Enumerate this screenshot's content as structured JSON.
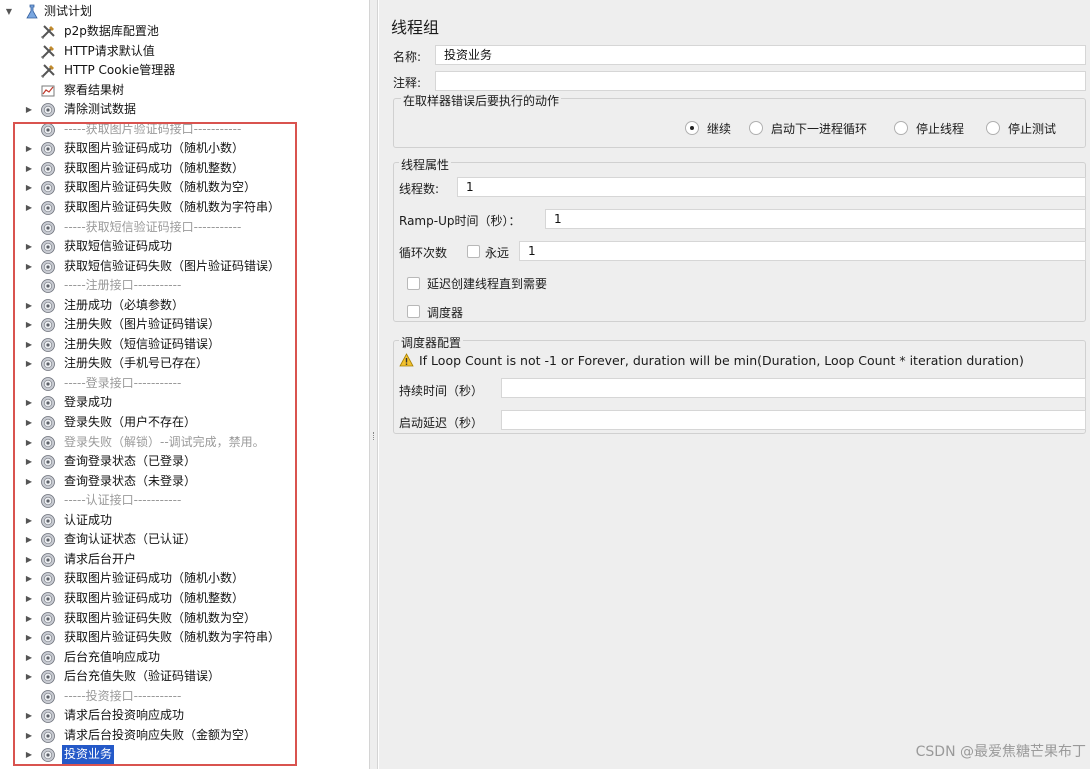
{
  "tree": {
    "root": {
      "label": "测试计划",
      "icon": "test-plan-icon"
    },
    "items": [
      {
        "label": "p2p数据库配置池",
        "icon": "config-tool-icon",
        "toggle": false,
        "disabled": false
      },
      {
        "label": "HTTP请求默认值",
        "icon": "config-tool-icon",
        "toggle": false,
        "disabled": false
      },
      {
        "label": "HTTP Cookie管理器",
        "icon": "config-tool-icon",
        "toggle": false,
        "disabled": false
      },
      {
        "label": "察看结果树",
        "icon": "listener-chart-icon",
        "toggle": false,
        "disabled": false
      },
      {
        "label": "清除测试数据",
        "icon": "thread-group-icon",
        "toggle": true,
        "disabled": false
      },
      {
        "label": "-----获取图片验证码接口-----------",
        "icon": "thread-group-icon",
        "toggle": false,
        "disabled": true
      },
      {
        "label": "获取图片验证码成功（随机小数）",
        "icon": "thread-group-icon",
        "toggle": true,
        "disabled": false
      },
      {
        "label": "获取图片验证码成功（随机整数）",
        "icon": "thread-group-icon",
        "toggle": true,
        "disabled": false
      },
      {
        "label": "获取图片验证码失败（随机数为空）",
        "icon": "thread-group-icon",
        "toggle": true,
        "disabled": false
      },
      {
        "label": "获取图片验证码失败（随机数为字符串）",
        "icon": "thread-group-icon",
        "toggle": true,
        "disabled": false
      },
      {
        "label": "-----获取短信验证码接口-----------",
        "icon": "thread-group-icon",
        "toggle": false,
        "disabled": true
      },
      {
        "label": "获取短信验证码成功",
        "icon": "thread-group-icon",
        "toggle": true,
        "disabled": false
      },
      {
        "label": "获取短信验证码失败（图片验证码错误）",
        "icon": "thread-group-icon",
        "toggle": true,
        "disabled": false
      },
      {
        "label": "-----注册接口-----------",
        "icon": "thread-group-icon",
        "toggle": false,
        "disabled": true
      },
      {
        "label": "注册成功（必填参数）",
        "icon": "thread-group-icon",
        "toggle": true,
        "disabled": false
      },
      {
        "label": "注册失败（图片验证码错误）",
        "icon": "thread-group-icon",
        "toggle": true,
        "disabled": false
      },
      {
        "label": "注册失败（短信验证码错误）",
        "icon": "thread-group-icon",
        "toggle": true,
        "disabled": false
      },
      {
        "label": "注册失败（手机号已存在）",
        "icon": "thread-group-icon",
        "toggle": true,
        "disabled": false
      },
      {
        "label": "-----登录接口-----------",
        "icon": "thread-group-icon",
        "toggle": false,
        "disabled": true
      },
      {
        "label": "登录成功",
        "icon": "thread-group-icon",
        "toggle": true,
        "disabled": false
      },
      {
        "label": "登录失败（用户不存在）",
        "icon": "thread-group-icon",
        "toggle": true,
        "disabled": false
      },
      {
        "label": "登录失败（解锁）--调试完成，禁用。",
        "icon": "thread-group-icon",
        "toggle": true,
        "disabled": true
      },
      {
        "label": "查询登录状态（已登录）",
        "icon": "thread-group-icon",
        "toggle": true,
        "disabled": false
      },
      {
        "label": "查询登录状态（未登录）",
        "icon": "thread-group-icon",
        "toggle": true,
        "disabled": false
      },
      {
        "label": "-----认证接口-----------",
        "icon": "thread-group-icon",
        "toggle": false,
        "disabled": true
      },
      {
        "label": "认证成功",
        "icon": "thread-group-icon",
        "toggle": true,
        "disabled": false
      },
      {
        "label": "查询认证状态（已认证）",
        "icon": "thread-group-icon",
        "toggle": true,
        "disabled": false
      },
      {
        "label": "请求后台开户",
        "icon": "thread-group-icon",
        "toggle": true,
        "disabled": false
      },
      {
        "label": "获取图片验证码成功（随机小数）",
        "icon": "thread-group-icon",
        "toggle": true,
        "disabled": false
      },
      {
        "label": "获取图片验证码成功（随机整数）",
        "icon": "thread-group-icon",
        "toggle": true,
        "disabled": false
      },
      {
        "label": "获取图片验证码失败（随机数为空）",
        "icon": "thread-group-icon",
        "toggle": true,
        "disabled": false
      },
      {
        "label": "获取图片验证码失败（随机数为字符串）",
        "icon": "thread-group-icon",
        "toggle": true,
        "disabled": false
      },
      {
        "label": "后台充值响应成功",
        "icon": "thread-group-icon",
        "toggle": true,
        "disabled": false
      },
      {
        "label": "后台充值失败（验证码错误）",
        "icon": "thread-group-icon",
        "toggle": true,
        "disabled": false
      },
      {
        "label": "-----投资接口-----------",
        "icon": "thread-group-icon",
        "toggle": false,
        "disabled": true
      },
      {
        "label": "请求后台投资响应成功",
        "icon": "thread-group-icon",
        "toggle": true,
        "disabled": false
      },
      {
        "label": "请求后台投资响应失败（金额为空）",
        "icon": "thread-group-icon",
        "toggle": true,
        "disabled": false
      },
      {
        "label": "投资业务",
        "icon": "thread-group-icon",
        "toggle": true,
        "disabled": false,
        "selected": true
      }
    ]
  },
  "panel": {
    "title": "线程组",
    "name_label": "名称:",
    "name_value": "投资业务",
    "comment_label": "注释:",
    "comment_value": "",
    "error_action": {
      "title": "在取样器错误后要执行的动作",
      "options": [
        "继续",
        "启动下一进程循环",
        "停止线程",
        "停止测试"
      ],
      "selected": "继续"
    },
    "thread_props": {
      "title": "线程属性",
      "threads_label": "线程数:",
      "threads_value": "1",
      "rampup_label": "Ramp-Up时间（秒）：",
      "rampup_value": "1",
      "loop_label": "循环次数",
      "forever_label": "永远",
      "loop_value": "1",
      "delay_label": "延迟创建线程直到需要",
      "scheduler_label": "调度器"
    },
    "scheduler": {
      "title": "调度器配置",
      "warning": "If Loop Count is not -1 or Forever, duration will be min(Duration, Loop Count * iteration duration)",
      "duration_label": "持续时间（秒）",
      "duration_value": "",
      "startup_label": "启动延迟（秒）",
      "startup_value": ""
    }
  },
  "watermark": "CSDN @最爱焦糖芒果布丁",
  "colors": {
    "selection_box": "#d9534f",
    "selected_bg": "#2459c8",
    "panel_bg": "#eeeeee"
  }
}
